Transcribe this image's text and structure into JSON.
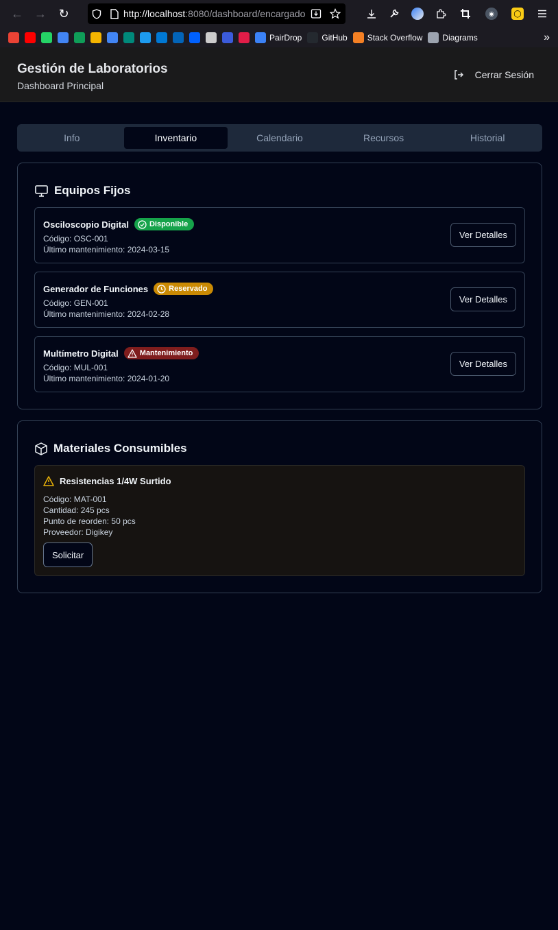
{
  "browser": {
    "url_host": "http://localhost",
    "url_rest": ":8080/dashboard/encargado",
    "bookmarks": [
      {
        "icon": "gmail-icon",
        "color": "#ea4335",
        "label": ""
      },
      {
        "icon": "youtube-icon",
        "color": "#ff0000",
        "label": ""
      },
      {
        "icon": "whatsapp-icon",
        "color": "#25d366",
        "label": ""
      },
      {
        "icon": "docs-icon",
        "color": "#4285f4",
        "label": ""
      },
      {
        "icon": "sheets-icon",
        "color": "#0f9d58",
        "label": ""
      },
      {
        "icon": "slides-icon",
        "color": "#f4b400",
        "label": ""
      },
      {
        "icon": "translate-icon",
        "color": "#4285f4",
        "label": ""
      },
      {
        "icon": "meet-icon",
        "color": "#00897b",
        "label": ""
      },
      {
        "icon": "tweetdeck-icon",
        "color": "#1d9bf0",
        "label": ""
      },
      {
        "icon": "outlook-icon",
        "color": "#0078d4",
        "label": ""
      },
      {
        "icon": "onedrive-icon",
        "color": "#0364b8",
        "label": ""
      },
      {
        "icon": "dropbox-icon",
        "color": "#0061ff",
        "label": ""
      },
      {
        "icon": "github-copilot-icon",
        "color": "#cccccc",
        "label": ""
      },
      {
        "icon": "circle-icon",
        "color": "#3b5bdb",
        "label": ""
      },
      {
        "icon": "scribd-icon",
        "color": "#e11d48",
        "label": ""
      },
      {
        "icon": "pairdrop-icon",
        "color": "#3b82f6",
        "label": "PairDrop"
      },
      {
        "icon": "github-icon",
        "color": "#24292f",
        "label": "GitHub"
      },
      {
        "icon": "stackoverflow-icon",
        "color": "#f48024",
        "label": "Stack Overflow"
      },
      {
        "icon": "diagrams-icon",
        "color": "#9ca3af",
        "label": "Diagrams"
      }
    ]
  },
  "header": {
    "title": "Gestión de Laboratorios",
    "subtitle": "Dashboard Principal",
    "logout_label": "Cerrar Sesión"
  },
  "tabs": [
    {
      "label": "Info",
      "active": false
    },
    {
      "label": "Inventario",
      "active": true
    },
    {
      "label": "Calendario",
      "active": false
    },
    {
      "label": "Recursos",
      "active": false
    },
    {
      "label": "Historial",
      "active": false
    }
  ],
  "equipos": {
    "title": "Equipos Fijos",
    "items": [
      {
        "name": "Osciloscopio Digital",
        "status": "Disponible",
        "status_color": "#16a34a",
        "code": "Código: OSC-001",
        "maintenance": "Último mantenimiento: 2024-03-15",
        "button": "Ver Detalles"
      },
      {
        "name": "Generador de Funciones",
        "status": "Reservado",
        "status_color": "#ca8a04",
        "code": "Código: GEN-001",
        "maintenance": "Último mantenimiento: 2024-02-28",
        "button": "Ver Detalles"
      },
      {
        "name": "Multímetro Digital",
        "status": "Mantenimiento",
        "status_color": "#7f1d1d",
        "code": "Código: MUL-001",
        "maintenance": "Último mantenimiento: 2024-01-20",
        "button": "Ver Detalles"
      }
    ]
  },
  "materiales": {
    "title": "Materiales Consumibles",
    "items": [
      {
        "name": "Resistencias 1/4W Surtido",
        "code": "Código: MAT-001",
        "quantity": "Cantidad: 245 pcs",
        "reorder": "Punto de reorden: 50 pcs",
        "supplier": "Proveedor: Digikey",
        "button": "Solicitar"
      }
    ]
  }
}
